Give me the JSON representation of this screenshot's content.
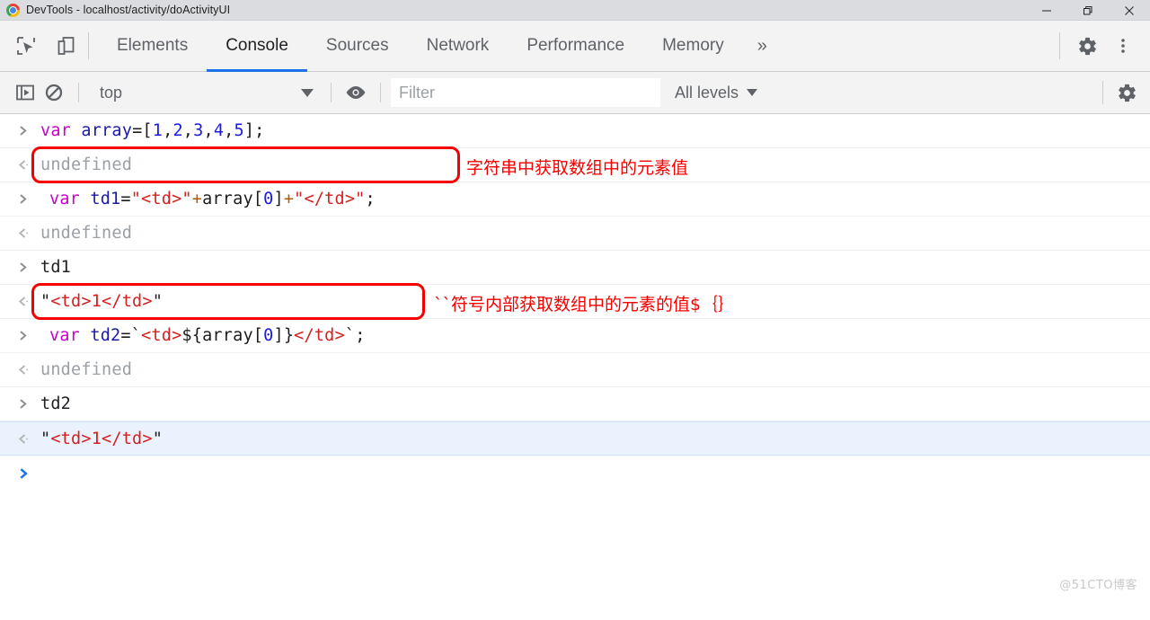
{
  "window": {
    "title": "DevTools - localhost/activity/doActivityUI",
    "logo_icon": "chrome-logo-icon",
    "controls": {
      "minimize_label": "Minimize",
      "restore_label": "Restore",
      "close_label": "Close"
    }
  },
  "tabstrip": {
    "inspect_icon": "inspect-element-icon",
    "device_icon": "device-toolbar-icon",
    "tabs": [
      {
        "label": "Elements",
        "active": false
      },
      {
        "label": "Console",
        "active": true
      },
      {
        "label": "Sources",
        "active": false
      },
      {
        "label": "Network",
        "active": false
      },
      {
        "label": "Performance",
        "active": false
      },
      {
        "label": "Memory",
        "active": false
      }
    ],
    "more_tabs_glyph": "»",
    "settings_icon": "gear-icon",
    "menu_icon": "more-vertical-icon"
  },
  "console_toolbar": {
    "sidebar_icon": "console-sidebar-toggle-icon",
    "clear_icon": "clear-console-icon",
    "context": "top",
    "context_caret": "chevron-down-icon",
    "eye_icon": "live-expression-eye-icon",
    "filter_placeholder": "Filter",
    "filter_value": "",
    "levels_label": "All levels",
    "levels_caret": "chevron-down-icon",
    "settings_icon": "console-settings-gear-icon"
  },
  "console": {
    "in_marker": "›",
    "out_marker": "‹",
    "rows": [
      {
        "type": "input",
        "text": "var array=[1,2,3,4,5];"
      },
      {
        "type": "output",
        "text": "undefined"
      },
      {
        "type": "input",
        "text": "var td1=\"<td>\"+array[0]+\"</td>\";"
      },
      {
        "type": "output",
        "text": "undefined"
      },
      {
        "type": "input",
        "text": "td1"
      },
      {
        "type": "output",
        "text": "\"<td>1</td>\""
      },
      {
        "type": "input",
        "text": "var td2=`<td>${array[0]}</td>`;"
      },
      {
        "type": "output",
        "text": "undefined"
      },
      {
        "type": "input",
        "text": "td2"
      },
      {
        "type": "output",
        "text": "\"<td>1</td>\"",
        "highlight": true
      },
      {
        "type": "prompt",
        "text": ""
      }
    ]
  },
  "annotations": [
    {
      "text": "字符串中获取数组中的元素值"
    },
    {
      "text": "``符号内部获取数组中的元素的值$｛｝"
    }
  ],
  "watermark": {
    "text": "@51CTO博客"
  },
  "colors": {
    "accent": "#1a73e8",
    "annotation": "#f40000",
    "string": "#d42020",
    "keyword": "#c800c8",
    "identifier": "#1a1aa8"
  }
}
